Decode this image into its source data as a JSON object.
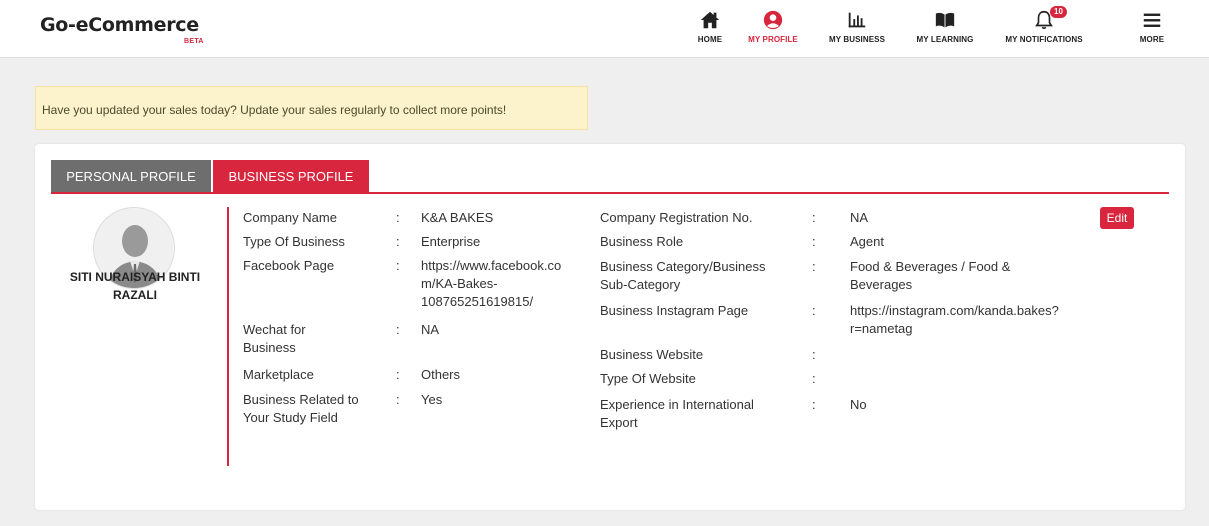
{
  "logo": {
    "text": "Go-eCommerce",
    "badge": "BETA"
  },
  "nav": [
    {
      "label": "HOME",
      "icon": "home-icon"
    },
    {
      "label": "MY PROFILE",
      "icon": "user-circle-icon",
      "active": true
    },
    {
      "label": "MY BUSINESS",
      "icon": "bar-chart-icon"
    },
    {
      "label": "MY LEARNING",
      "icon": "book-icon"
    },
    {
      "label": "MY NOTIFICATIONS",
      "icon": "bell-icon",
      "badge": "10"
    },
    {
      "label": "MORE",
      "icon": "hamburger-menu-icon"
    }
  ],
  "alert": {
    "text": "Have you updated your sales today? Update your sales regularly to collect more points!"
  },
  "tabs": {
    "personal": "PERSONAL PROFILE",
    "business": "BUSINESS PROFILE"
  },
  "profile": {
    "name_line1": "SITI NURAISYAH BINTI",
    "name_line2": "RAZALI"
  },
  "separator": ":",
  "left_fields": {
    "company_name": {
      "label": "Company Name",
      "value": "K&A BAKES"
    },
    "type_of_business": {
      "label": "Type Of Business",
      "value": "Enterprise"
    },
    "facebook": {
      "label": "Facebook Page",
      "value_l1": "https://www.facebook.co",
      "value_l2": "m/KA-Bakes-",
      "value_l3": "108765251619815/"
    },
    "wechat": {
      "label_l1": "Wechat for",
      "label_l2": "Business",
      "value": "NA"
    },
    "marketplace": {
      "label": "Marketplace",
      "value": "Others"
    },
    "study_field": {
      "label_l1": "Business Related to",
      "label_l2": "Your Study Field",
      "value": "Yes"
    }
  },
  "right_fields": {
    "registration": {
      "label": "Company Registration No.",
      "value": "NA"
    },
    "role": {
      "label": "Business Role",
      "value": "Agent"
    },
    "category": {
      "label_l1": "Business Category/Business",
      "label_l2": "Sub-Category",
      "value_l1": "Food & Beverages / Food &",
      "value_l2": "Beverages"
    },
    "instagram": {
      "label": "Business Instagram Page",
      "value_l1": "https://instagram.com/kanda.bakes?",
      "value_l2": "r=nametag"
    },
    "website": {
      "label": "Business Website",
      "value": ""
    },
    "website_type": {
      "label": "Type Of Website",
      "value": ""
    },
    "export": {
      "label_l1": "Experience in International",
      "label_l2": "Export",
      "value": "No"
    }
  },
  "edit_label": "Edit",
  "colors": {
    "accent": "#d7263d",
    "tab_inactive": "#6e6e6e",
    "alert_bg": "#fcf2cc"
  }
}
